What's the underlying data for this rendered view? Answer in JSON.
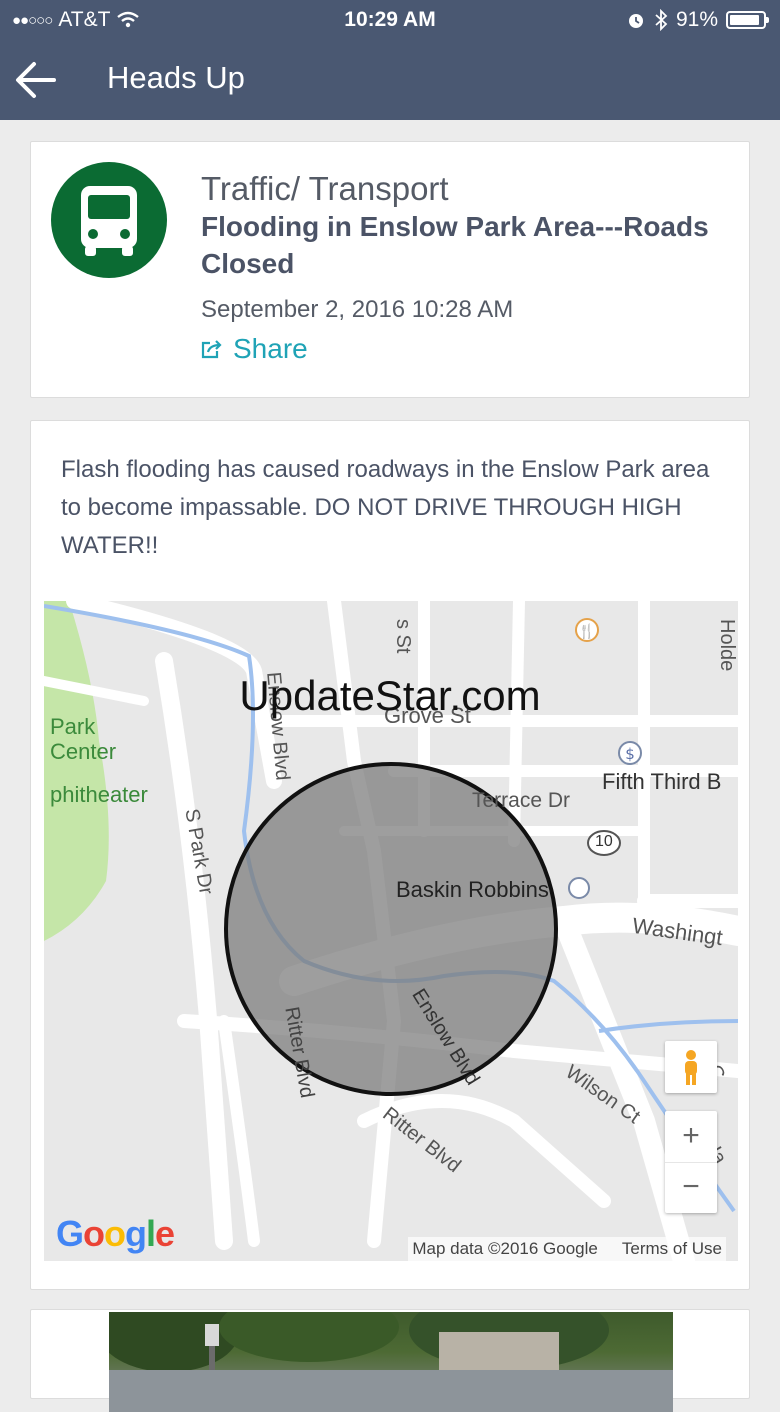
{
  "status_bar": {
    "carrier": "AT&T",
    "time": "10:29 AM",
    "battery": "91%",
    "battery_level": 0.91
  },
  "nav": {
    "title": "Heads Up"
  },
  "alert": {
    "category": "Traffic/ Transport",
    "headline": "Flooding in Enslow Park Area---Roads Closed",
    "datetime": "September 2, 2016 10:28 AM",
    "share_label": "Share",
    "category_color": "#0b6b33",
    "accent_color": "#1fa3b6"
  },
  "description": "Flash flooding has caused roadways in the Enslow Park area to become impassable. DO NOT DRIVE THROUGH HIGH WATER!!",
  "map": {
    "labels": {
      "park_center": "Park Center",
      "amphitheater": "phitheater",
      "s_st": "s St",
      "grove_st": "Grove St",
      "holderby": "Holde",
      "fifth_third": "Fifth Third B",
      "terrace_dr": "Terrace Dr",
      "route_10": "10",
      "baskin_robbins": "Baskin Robbins",
      "washington": "Washingt",
      "s_park_dr": "S Park Dr",
      "enslow_blvd_top": "Enslow Blvd",
      "enslow_blvd": "Enslow Blvd",
      "ritter_blvd_v": "Ritter Blvd",
      "ritter_blvd": "Ritter Blvd",
      "wilson_ct": "Wilson Ct",
      "ha": "Ha",
      "c": "C"
    },
    "zoom_in": "+",
    "zoom_out": "−",
    "google_logo": "Google",
    "attribution": "Map data ©2016 Google",
    "terms": "Terms of Use"
  },
  "watermark": "UpdateStar.com"
}
